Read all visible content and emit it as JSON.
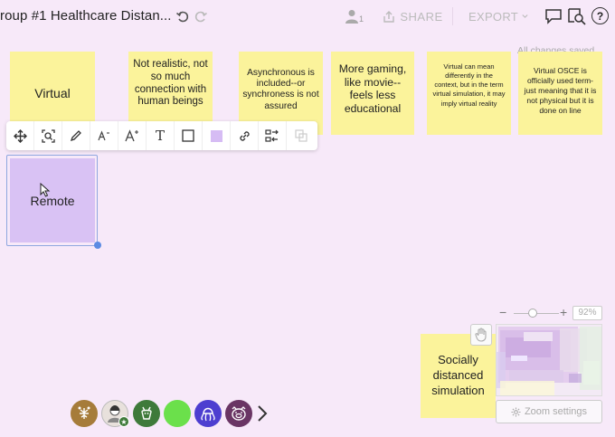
{
  "header": {
    "board_title": "roup #1 Healthcare Distan...",
    "user_count": "1",
    "share_label": "SHARE",
    "export_label": "EXPORT",
    "save_status": "All changes saved"
  },
  "notes": {
    "virtual": "Virtual",
    "not_realistic": "Not realistic, not so much connection with human beings",
    "asynchronous": "Asynchronous is included--or synchroness is not assured",
    "gaming": "More gaming, like movie--feels less educational",
    "virtual_mean": "Virtual can mean differently in the context, but in the term virtual simulation, it may imply virtual reality",
    "osce": "Virtual OSCE is officially used term-just meaning that it is not physical but it is done on line",
    "socially": "Socially distanced simulation",
    "remote": "Remote"
  },
  "toolbar": {
    "text_tool": "T"
  },
  "zoom": {
    "minus": "−",
    "plus": "+",
    "percent": "92%",
    "settings_label": "Zoom settings"
  },
  "colors": {
    "canvas": "#f7e9f9",
    "sticky_yellow": "#fbf39b",
    "sticky_purple": "#d9c2f4",
    "selection_blue": "#5b8be3"
  }
}
